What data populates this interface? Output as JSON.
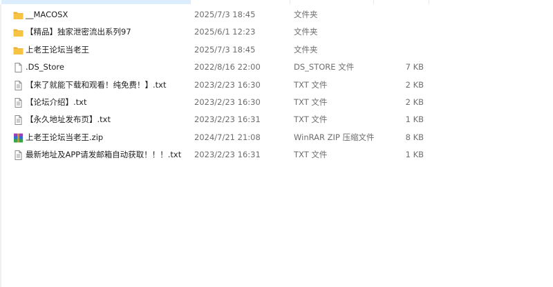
{
  "files": [
    {
      "name": "__MACOSX",
      "date": "2025/7/3 18:45",
      "type": "文件夹",
      "size": "",
      "icon": "folder-icon"
    },
    {
      "name": "【精品】独家泄密流出系列97",
      "date": "2025/6/1 12:23",
      "type": "文件夹",
      "size": "",
      "icon": "folder-icon"
    },
    {
      "name": "上老王论坛当老王",
      "date": "2025/7/3 18:45",
      "type": "文件夹",
      "size": "",
      "icon": "folder-icon"
    },
    {
      "name": ".DS_Store",
      "date": "2022/8/16 22:00",
      "type": "DS_STORE 文件",
      "size": "7 KB",
      "icon": "file-icon"
    },
    {
      "name": "【来了就能下载和观看！纯免费！】.txt",
      "date": "2023/2/23 16:30",
      "type": "TXT 文件",
      "size": "2 KB",
      "icon": "text-file-icon"
    },
    {
      "name": "【论坛介绍】.txt",
      "date": "2023/2/23 16:30",
      "type": "TXT 文件",
      "size": "2 KB",
      "icon": "text-file-icon"
    },
    {
      "name": "【永久地址发布页】.txt",
      "date": "2023/2/23 16:31",
      "type": "TXT 文件",
      "size": "1 KB",
      "icon": "text-file-icon"
    },
    {
      "name": "上老王论坛当老王.zip",
      "date": "2024/7/21 21:08",
      "type": "WinRAR ZIP 压缩文件",
      "size": "8 KB",
      "icon": "winrar-archive-icon"
    },
    {
      "name": "最新地址及APP请发邮箱自动获取！！！.txt",
      "date": "2023/2/23 16:31",
      "type": "TXT 文件",
      "size": "1 KB",
      "icon": "text-file-icon"
    }
  ],
  "colors": {
    "folder": "#f6c343",
    "selection": "#dceefe",
    "text": "#1f1f1f",
    "secondary_text": "#6d6d6d"
  }
}
